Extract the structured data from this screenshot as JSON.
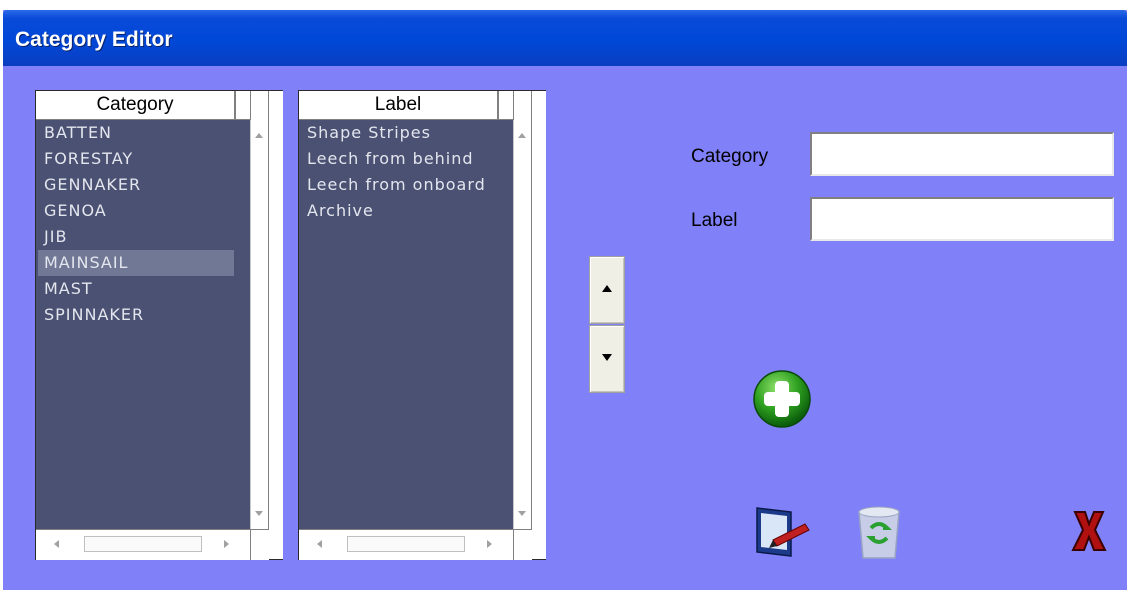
{
  "window": {
    "title": "Category Editor"
  },
  "category_list": {
    "header": "Category",
    "items": [
      "BATTEN",
      "FORESTAY",
      "GENNAKER",
      "GENOA",
      "JIB",
      "MAINSAIL",
      "MAST",
      "SPINNAKER"
    ],
    "selected_index": 5
  },
  "label_list": {
    "header": "Label",
    "items": [
      "Shape Stripes",
      "Leech from behind",
      "Leech from onboard",
      "Archive"
    ]
  },
  "form": {
    "category_label": "Category",
    "category_value": "",
    "label_label": "Label",
    "label_value": ""
  },
  "icons": {
    "move_up": "arrow-up-icon",
    "move_down": "arrow-down-icon",
    "add": "green-plus-icon",
    "edit": "edit-pen-icon",
    "recycle": "recycle-bin-icon",
    "close": "red-x-icon"
  },
  "colors": {
    "window_bg": "#8080f8",
    "titlebar": "#0048d8",
    "list_bg": "#4a5172",
    "list_selected": "#717896"
  }
}
